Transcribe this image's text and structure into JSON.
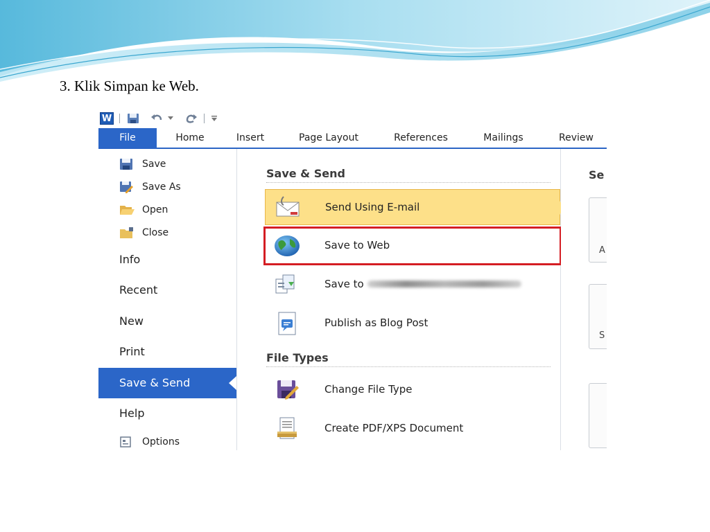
{
  "slide": {
    "step_text": "3. Klik Simpan ke Web."
  },
  "word": {
    "quick_access": {
      "logo_letter": "W",
      "icons": [
        "save-icon",
        "undo-icon",
        "dropdown-arrow-icon",
        "redo-icon",
        "customize-toolbar-icon"
      ]
    },
    "ribbon_tabs": [
      "File",
      "Home",
      "Insert",
      "Page Layout",
      "References",
      "Mailings",
      "Review"
    ],
    "left_nav": {
      "save": "Save",
      "save_as": "Save As",
      "open": "Open",
      "close": "Close",
      "info": "Info",
      "recent": "Recent",
      "new": "New",
      "print": "Print",
      "save_send": "Save & Send",
      "help": "Help",
      "options": "Options"
    },
    "save_send": {
      "title": "Save & Send",
      "items": {
        "email": "Send Using E-mail",
        "web": "Save to Web",
        "sharepoint": "Save to",
        "blog": "Publish as Blog Post"
      }
    },
    "file_types": {
      "title": "File Types",
      "items": {
        "change": "Change File Type",
        "pdf": "Create PDF/XPS Document"
      }
    },
    "right_panel": {
      "title": "Se",
      "card1_letter": "A",
      "card2_letter": "S"
    }
  },
  "colors": {
    "accent_blue": "#2b66c8",
    "selected_yellow": "#fde089",
    "highlight_red": "#d41d23"
  }
}
